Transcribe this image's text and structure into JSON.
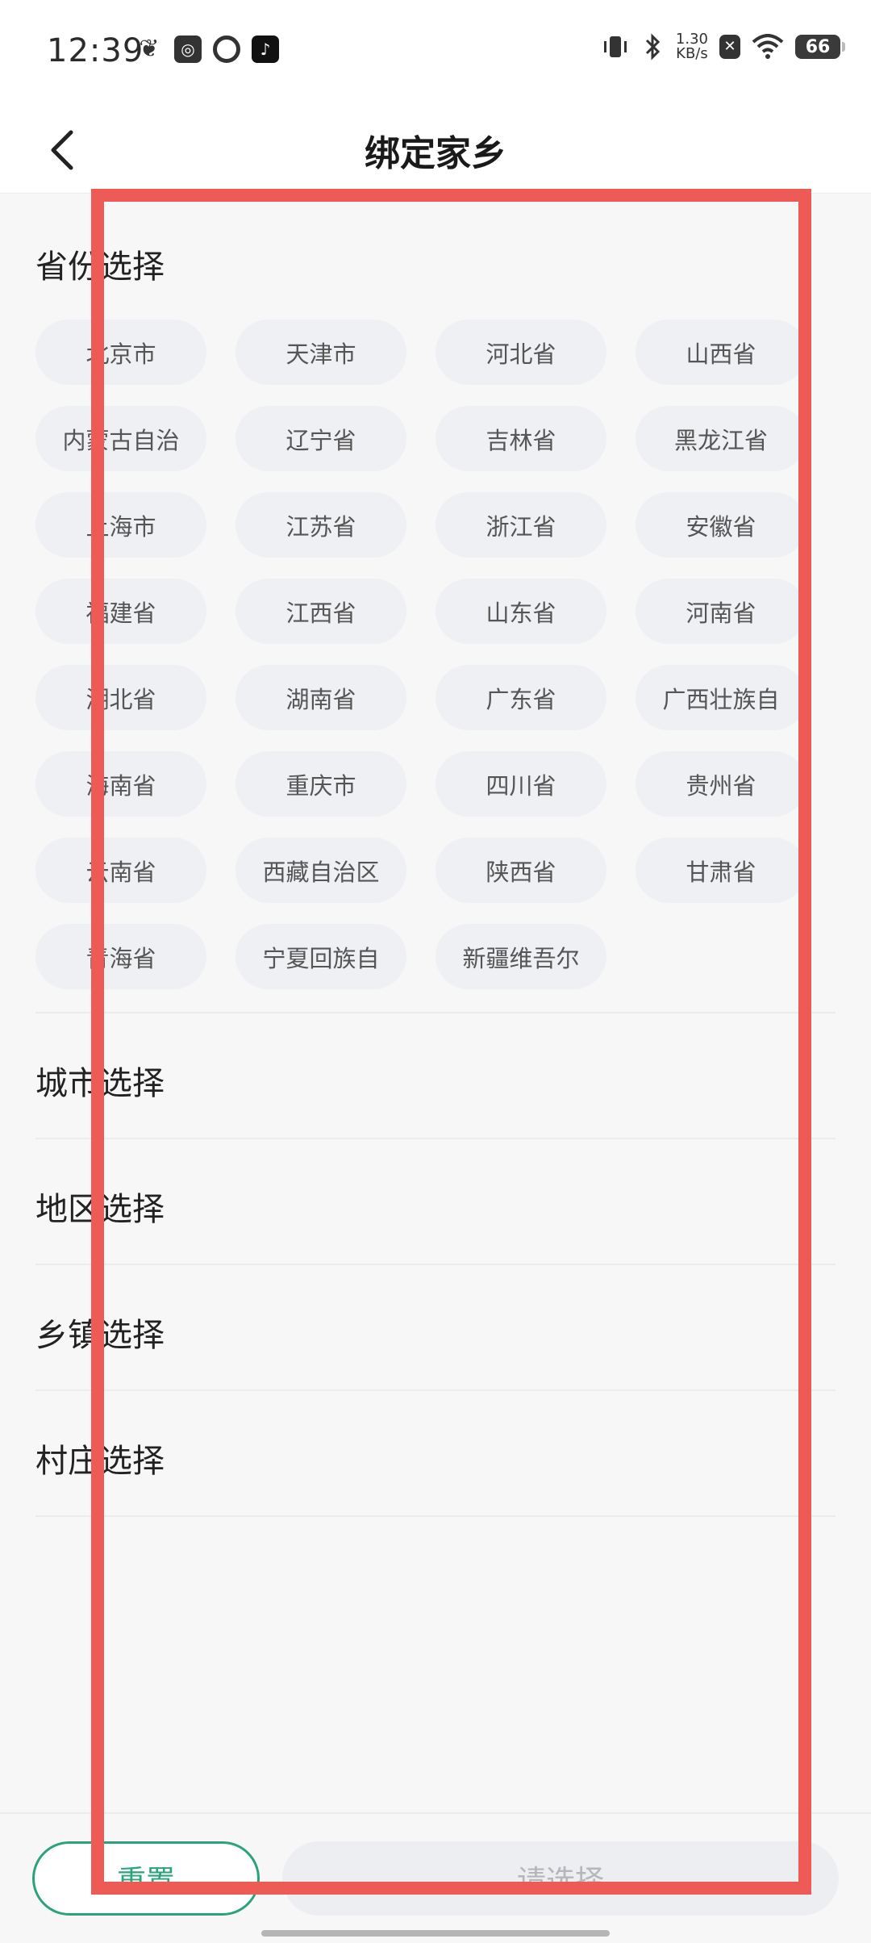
{
  "status_bar": {
    "time": "12:39",
    "net_speed_value": "1.30",
    "net_speed_unit": "KB/s",
    "battery": "66",
    "app_icons": [
      "feather-icon",
      "camera-settings-icon",
      "message-icon",
      "tiktok-icon"
    ]
  },
  "header": {
    "title": "绑定家乡",
    "back_icon": "chevron-left-icon"
  },
  "province_section": {
    "title": "省份选择",
    "items": [
      "北京市",
      "天津市",
      "河北省",
      "山西省",
      "内蒙古自治",
      "辽宁省",
      "吉林省",
      "黑龙江省",
      "上海市",
      "江苏省",
      "浙江省",
      "安徽省",
      "福建省",
      "江西省",
      "山东省",
      "河南省",
      "湖北省",
      "湖南省",
      "广东省",
      "广西壮族自",
      "海南省",
      "重庆市",
      "四川省",
      "贵州省",
      "云南省",
      "西藏自治区",
      "陕西省",
      "甘肃省",
      "青海省",
      "宁夏回族自",
      "新疆维吾尔"
    ]
  },
  "rows": {
    "city": "城市选择",
    "district": "地区选择",
    "town": "乡镇选择",
    "village": "村庄选择"
  },
  "footer": {
    "reset_label": "重置",
    "confirm_label": "请选择"
  },
  "colors": {
    "accent": "#2aa37a",
    "highlight": "#ee5a55",
    "chip_bg": "#eef0f3"
  }
}
